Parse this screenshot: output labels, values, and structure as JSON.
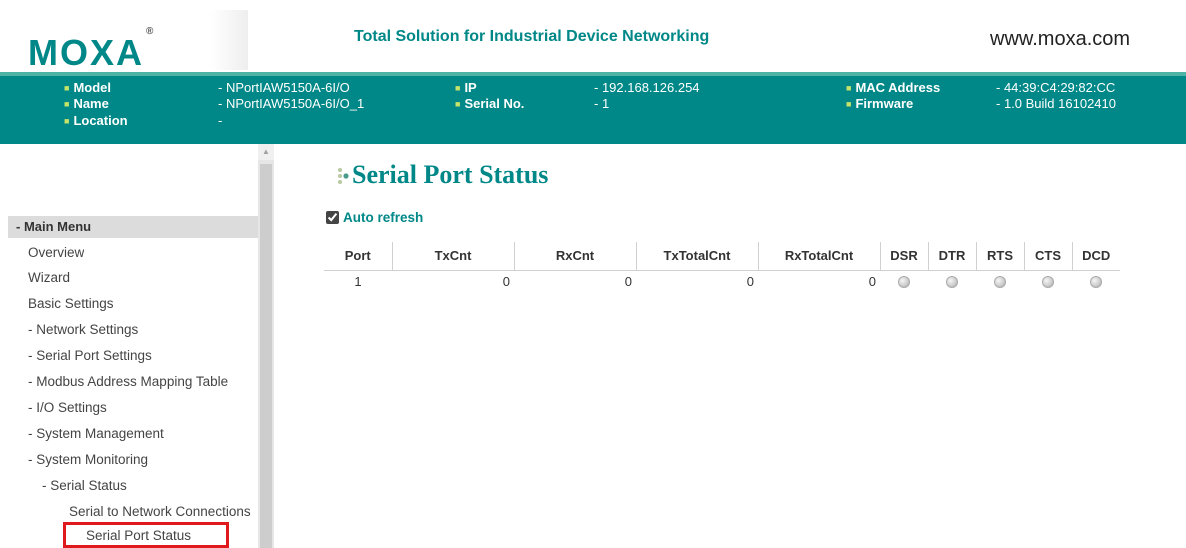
{
  "header": {
    "logo_text": "MOXA",
    "logo_mark": "®",
    "tagline": "Total Solution for Industrial Device Networking",
    "website": "www.moxa.com"
  },
  "device_info": {
    "model_label": "Model",
    "model_value": "- NPortIAW5150A-6I/O",
    "name_label": "Name",
    "name_value": "- NPortIAW5150A-6I/O_1",
    "location_label": "Location",
    "location_value": "-",
    "ip_label": "IP",
    "ip_value": "- 192.168.126.254",
    "serial_label": "Serial No.",
    "serial_value": "- 1",
    "mac_label": "MAC Address",
    "mac_value": "- 44:39:C4:29:82:CC",
    "firmware_label": "Firmware",
    "firmware_value": "- 1.0 Build 16102410"
  },
  "sidebar": {
    "header": "- Main Menu",
    "items": [
      "Overview",
      "Wizard",
      "Basic Settings",
      "- Network Settings",
      "- Serial Port Settings",
      "- Modbus Address Mapping Table",
      "- I/O Settings",
      "- System Management",
      "- System Monitoring",
      "- Serial Status",
      "Serial to Network Connections",
      "Serial Port Status"
    ],
    "selected": "Serial Port Status"
  },
  "main": {
    "title": "Serial Port Status",
    "auto_refresh_label": "Auto refresh",
    "auto_refresh_checked": true,
    "table": {
      "headers": [
        "Port",
        "TxCnt",
        "RxCnt",
        "TxTotalCnt",
        "RxTotalCnt",
        "DSR",
        "DTR",
        "RTS",
        "CTS",
        "DCD"
      ],
      "rows": [
        {
          "port": "1",
          "txcnt": "0",
          "rxcnt": "0",
          "txtotal": "0",
          "rxtotal": "0",
          "dsr": "off",
          "dtr": "off",
          "rts": "off",
          "cts": "off",
          "dcd": "off"
        }
      ]
    }
  },
  "colors": {
    "brand": "#008787",
    "highlight_border": "#e0191c",
    "led_off": "#cfcfcf"
  }
}
